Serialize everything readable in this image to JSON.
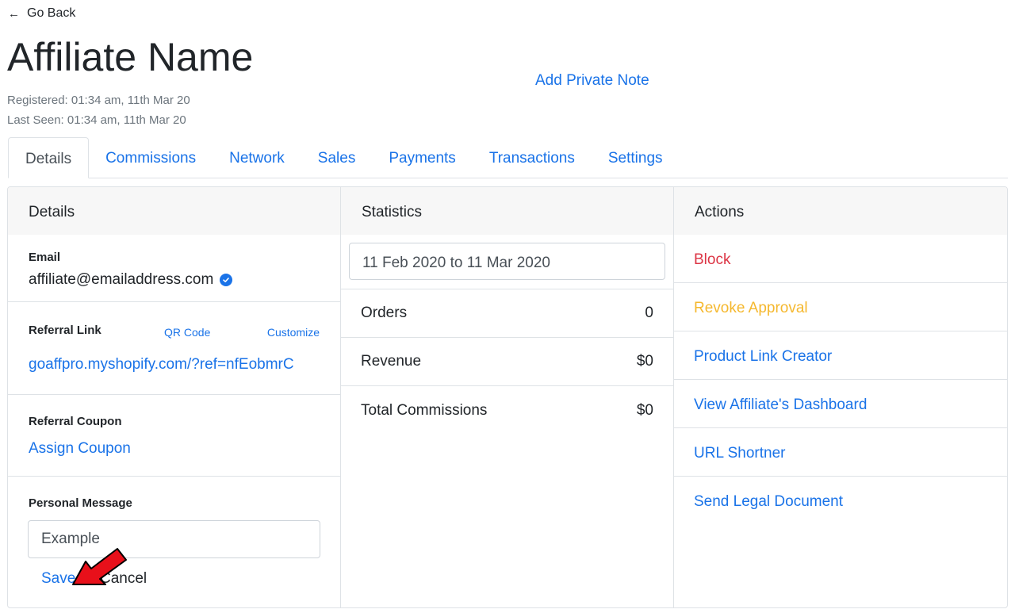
{
  "header": {
    "back_label": "Go Back",
    "title": "Affiliate Name",
    "registered": "Registered: 01:34 am, 11th Mar 20",
    "last_seen": "Last Seen: 01:34 am, 11th Mar 20",
    "private_note_label": "Add Private Note"
  },
  "tabs": [
    {
      "label": "Details",
      "active": true
    },
    {
      "label": "Commissions"
    },
    {
      "label": "Network"
    },
    {
      "label": "Sales"
    },
    {
      "label": "Payments"
    },
    {
      "label": "Transactions"
    },
    {
      "label": "Settings"
    }
  ],
  "details": {
    "heading": "Details",
    "email_label": "Email",
    "email_value": "affiliate@emailaddress.com",
    "referral_link_label": "Referral Link",
    "qr_code_label": "QR Code",
    "customize_label": "Customize",
    "referral_link": "goaffpro.myshopify.com/?ref=nfEobmrC",
    "coupon_label": "Referral Coupon",
    "assign_coupon_label": "Assign Coupon",
    "message_label": "Personal Message",
    "message_value": "Example",
    "save_label": "Save",
    "cancel_label": "Cancel"
  },
  "statistics": {
    "heading": "Statistics",
    "date_range": "11 Feb 2020 to 11 Mar 2020",
    "rows": [
      {
        "label": "Orders",
        "value": "0"
      },
      {
        "label": "Revenue",
        "value": "$0"
      },
      {
        "label": "Total Commissions",
        "value": "$0"
      }
    ]
  },
  "actions": {
    "heading": "Actions",
    "items": [
      {
        "label": "Block",
        "color": "#dc3545"
      },
      {
        "label": "Revoke Approval",
        "color": "#f5b82e"
      },
      {
        "label": "Product Link Creator",
        "color": "#1a73e8"
      },
      {
        "label": "View Affiliate's Dashboard",
        "color": "#1a73e8"
      },
      {
        "label": "URL Shortner",
        "color": "#1a73e8"
      },
      {
        "label": "Send Legal Document",
        "color": "#1a73e8"
      }
    ]
  },
  "colors": {
    "link": "#1a73e8",
    "danger": "#dc3545",
    "warning": "#f5b82e",
    "annotation_arrow": "#e8101a"
  }
}
